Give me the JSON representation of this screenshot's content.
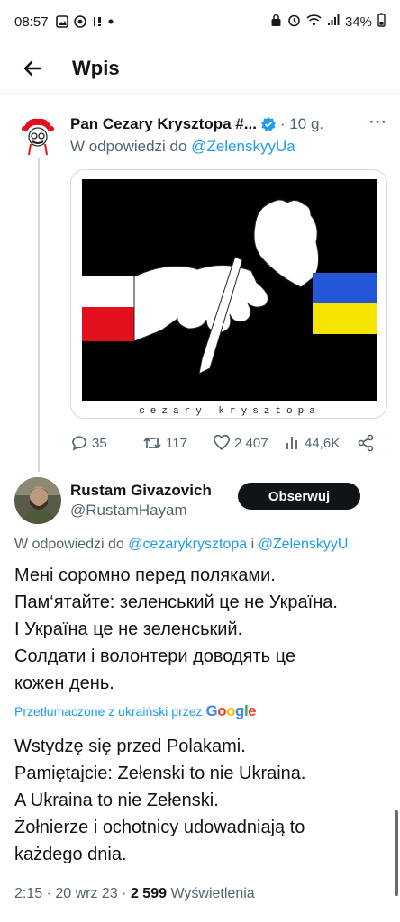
{
  "status_bar": {
    "time": "08:57",
    "battery": "34%"
  },
  "header": {
    "title": "Wpis"
  },
  "parent_tweet": {
    "name": "Pan Cezary Krysztopa #...",
    "time": "· 10 g.",
    "more": "···",
    "reply_prefix": "W odpowiedzi do ",
    "reply_mention": "@ZelenskyyUa",
    "cartoon_signature": "cezary krysztopa",
    "stats": {
      "replies": "35",
      "retweets": "117",
      "likes": "2 407",
      "views": "44,6K"
    }
  },
  "main_tweet": {
    "name": "Rustam Givazovich",
    "handle": "@RustamHayam",
    "follow_label": "Obserwuj",
    "reply_prefix": "W odpowiedzi do ",
    "reply_mention_1": "@cezarykrysztopa",
    "reply_join": " i ",
    "reply_mention_2": "@ZelenskyyU",
    "text_lines": [
      "Мені соромно перед поляками.",
      "Пам‘ятайте: зеленський це не Україна.",
      "І Україна це не зеленський.",
      "Солдати і волонтери доводять це",
      "кожен день."
    ],
    "translated_label": "Przetłumaczone z ukraiński przez",
    "translator": "Google",
    "translation_lines": [
      "Wstydzę się przed Polakami.",
      "Pamiętajcie: Zełenski to nie Ukraina.",
      "A Ukraina to nie Zełenski.",
      "Żołnierze i ochotnicy udowadniają to",
      "każdego dnia."
    ],
    "meta_time": "2:15 · 20 wrz 23 · ",
    "meta_views_count": "2 599",
    "meta_views_label": " Wyświetlenia"
  },
  "colors": {
    "accent": "#1d9bf0",
    "text": "#0f1419",
    "muted": "#536471",
    "poland_red": "#e2101c",
    "ukraine_blue": "#2457d8",
    "ukraine_yellow": "#f5e400"
  }
}
